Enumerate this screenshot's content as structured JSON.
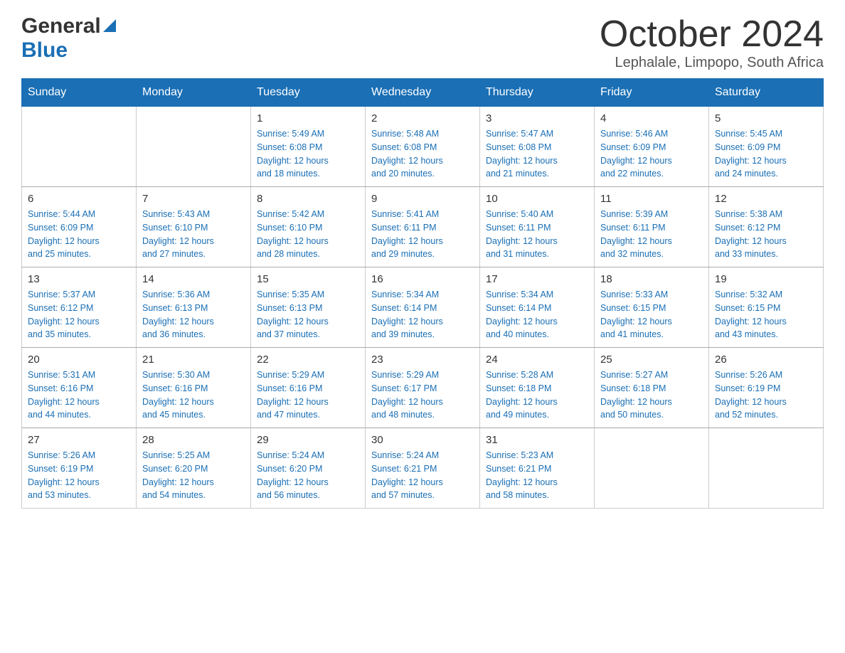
{
  "header": {
    "logo_general": "General",
    "logo_blue": "Blue",
    "month_title": "October 2024",
    "location": "Lephalale, Limpopo, South Africa"
  },
  "days_of_week": [
    "Sunday",
    "Monday",
    "Tuesday",
    "Wednesday",
    "Thursday",
    "Friday",
    "Saturday"
  ],
  "weeks": [
    [
      {
        "day": "",
        "info": ""
      },
      {
        "day": "",
        "info": ""
      },
      {
        "day": "1",
        "info": "Sunrise: 5:49 AM\nSunset: 6:08 PM\nDaylight: 12 hours\nand 18 minutes."
      },
      {
        "day": "2",
        "info": "Sunrise: 5:48 AM\nSunset: 6:08 PM\nDaylight: 12 hours\nand 20 minutes."
      },
      {
        "day": "3",
        "info": "Sunrise: 5:47 AM\nSunset: 6:08 PM\nDaylight: 12 hours\nand 21 minutes."
      },
      {
        "day": "4",
        "info": "Sunrise: 5:46 AM\nSunset: 6:09 PM\nDaylight: 12 hours\nand 22 minutes."
      },
      {
        "day": "5",
        "info": "Sunrise: 5:45 AM\nSunset: 6:09 PM\nDaylight: 12 hours\nand 24 minutes."
      }
    ],
    [
      {
        "day": "6",
        "info": "Sunrise: 5:44 AM\nSunset: 6:09 PM\nDaylight: 12 hours\nand 25 minutes."
      },
      {
        "day": "7",
        "info": "Sunrise: 5:43 AM\nSunset: 6:10 PM\nDaylight: 12 hours\nand 27 minutes."
      },
      {
        "day": "8",
        "info": "Sunrise: 5:42 AM\nSunset: 6:10 PM\nDaylight: 12 hours\nand 28 minutes."
      },
      {
        "day": "9",
        "info": "Sunrise: 5:41 AM\nSunset: 6:11 PM\nDaylight: 12 hours\nand 29 minutes."
      },
      {
        "day": "10",
        "info": "Sunrise: 5:40 AM\nSunset: 6:11 PM\nDaylight: 12 hours\nand 31 minutes."
      },
      {
        "day": "11",
        "info": "Sunrise: 5:39 AM\nSunset: 6:11 PM\nDaylight: 12 hours\nand 32 minutes."
      },
      {
        "day": "12",
        "info": "Sunrise: 5:38 AM\nSunset: 6:12 PM\nDaylight: 12 hours\nand 33 minutes."
      }
    ],
    [
      {
        "day": "13",
        "info": "Sunrise: 5:37 AM\nSunset: 6:12 PM\nDaylight: 12 hours\nand 35 minutes."
      },
      {
        "day": "14",
        "info": "Sunrise: 5:36 AM\nSunset: 6:13 PM\nDaylight: 12 hours\nand 36 minutes."
      },
      {
        "day": "15",
        "info": "Sunrise: 5:35 AM\nSunset: 6:13 PM\nDaylight: 12 hours\nand 37 minutes."
      },
      {
        "day": "16",
        "info": "Sunrise: 5:34 AM\nSunset: 6:14 PM\nDaylight: 12 hours\nand 39 minutes."
      },
      {
        "day": "17",
        "info": "Sunrise: 5:34 AM\nSunset: 6:14 PM\nDaylight: 12 hours\nand 40 minutes."
      },
      {
        "day": "18",
        "info": "Sunrise: 5:33 AM\nSunset: 6:15 PM\nDaylight: 12 hours\nand 41 minutes."
      },
      {
        "day": "19",
        "info": "Sunrise: 5:32 AM\nSunset: 6:15 PM\nDaylight: 12 hours\nand 43 minutes."
      }
    ],
    [
      {
        "day": "20",
        "info": "Sunrise: 5:31 AM\nSunset: 6:16 PM\nDaylight: 12 hours\nand 44 minutes."
      },
      {
        "day": "21",
        "info": "Sunrise: 5:30 AM\nSunset: 6:16 PM\nDaylight: 12 hours\nand 45 minutes."
      },
      {
        "day": "22",
        "info": "Sunrise: 5:29 AM\nSunset: 6:16 PM\nDaylight: 12 hours\nand 47 minutes."
      },
      {
        "day": "23",
        "info": "Sunrise: 5:29 AM\nSunset: 6:17 PM\nDaylight: 12 hours\nand 48 minutes."
      },
      {
        "day": "24",
        "info": "Sunrise: 5:28 AM\nSunset: 6:18 PM\nDaylight: 12 hours\nand 49 minutes."
      },
      {
        "day": "25",
        "info": "Sunrise: 5:27 AM\nSunset: 6:18 PM\nDaylight: 12 hours\nand 50 minutes."
      },
      {
        "day": "26",
        "info": "Sunrise: 5:26 AM\nSunset: 6:19 PM\nDaylight: 12 hours\nand 52 minutes."
      }
    ],
    [
      {
        "day": "27",
        "info": "Sunrise: 5:26 AM\nSunset: 6:19 PM\nDaylight: 12 hours\nand 53 minutes."
      },
      {
        "day": "28",
        "info": "Sunrise: 5:25 AM\nSunset: 6:20 PM\nDaylight: 12 hours\nand 54 minutes."
      },
      {
        "day": "29",
        "info": "Sunrise: 5:24 AM\nSunset: 6:20 PM\nDaylight: 12 hours\nand 56 minutes."
      },
      {
        "day": "30",
        "info": "Sunrise: 5:24 AM\nSunset: 6:21 PM\nDaylight: 12 hours\nand 57 minutes."
      },
      {
        "day": "31",
        "info": "Sunrise: 5:23 AM\nSunset: 6:21 PM\nDaylight: 12 hours\nand 58 minutes."
      },
      {
        "day": "",
        "info": ""
      },
      {
        "day": "",
        "info": ""
      }
    ]
  ]
}
